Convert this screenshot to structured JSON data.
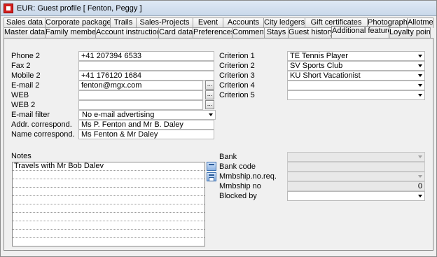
{
  "window": {
    "title": "EUR: Guest profile [ Fenton, Peggy ]"
  },
  "tabs_row1": [
    "Sales data",
    "Corporate package",
    "Trails",
    "Sales-Projects",
    "Event",
    "Accounts",
    "City ledgers",
    "Gift certificates",
    "Photograph",
    "Allotment"
  ],
  "tabs_row2": [
    "Master data",
    "Family member",
    "Account instructions",
    "Card data",
    "Preferences",
    "Comment",
    "Stays",
    "Guest history",
    "Additional features",
    "Loyalty points"
  ],
  "active_tab": "Additional features",
  "contact": {
    "phone2_label": "Phone 2",
    "phone2_value": "+41 207394 6533",
    "fax2_label": "Fax 2",
    "fax2_value": "",
    "mobile2_label": "Mobile 2",
    "mobile2_value": "+41 176120 1684",
    "email2_label": "E-mail 2",
    "email2_value": "fenton@mgx.com",
    "web_label": "WEB",
    "web_value": "",
    "web2_label": "WEB 2",
    "web2_value": "",
    "emailfilter_label": "E-mail filter",
    "emailfilter_value": "No e-mail advertising",
    "addr_label": "Addr. correspond.",
    "addr_value": "Ms P. Fenton and Mr B. Daley",
    "name_label": "Name correspond.",
    "name_value": "Ms Fenton & Mr Daley",
    "ellipsis": "..."
  },
  "criteria": {
    "c1_label": "Criterion 1",
    "c1_value": "TE  Tennis Player",
    "c2_label": "Criterion 2",
    "c2_value": "SV Sports Club",
    "c3_label": "Criterion 3",
    "c3_value": "KU Short Vacationist",
    "c4_label": "Criterion 4",
    "c4_value": "",
    "c5_label": "Criterion 5",
    "c5_value": ""
  },
  "notes": {
    "label": "Notes",
    "text": "Travels with Mr Bob Dalev"
  },
  "bank": {
    "bank_label": "Bank",
    "bank_value": "",
    "bankcode_label": "Bank code",
    "bankcode_value": "",
    "mmbship_noreq_label": "Mmbship.no.req.",
    "mmbship_noreq_value": "",
    "mmbship_no_label": "Mmbship no",
    "mmbship_no_value": "0",
    "blockedby_label": "Blocked by",
    "blockedby_value": ""
  }
}
